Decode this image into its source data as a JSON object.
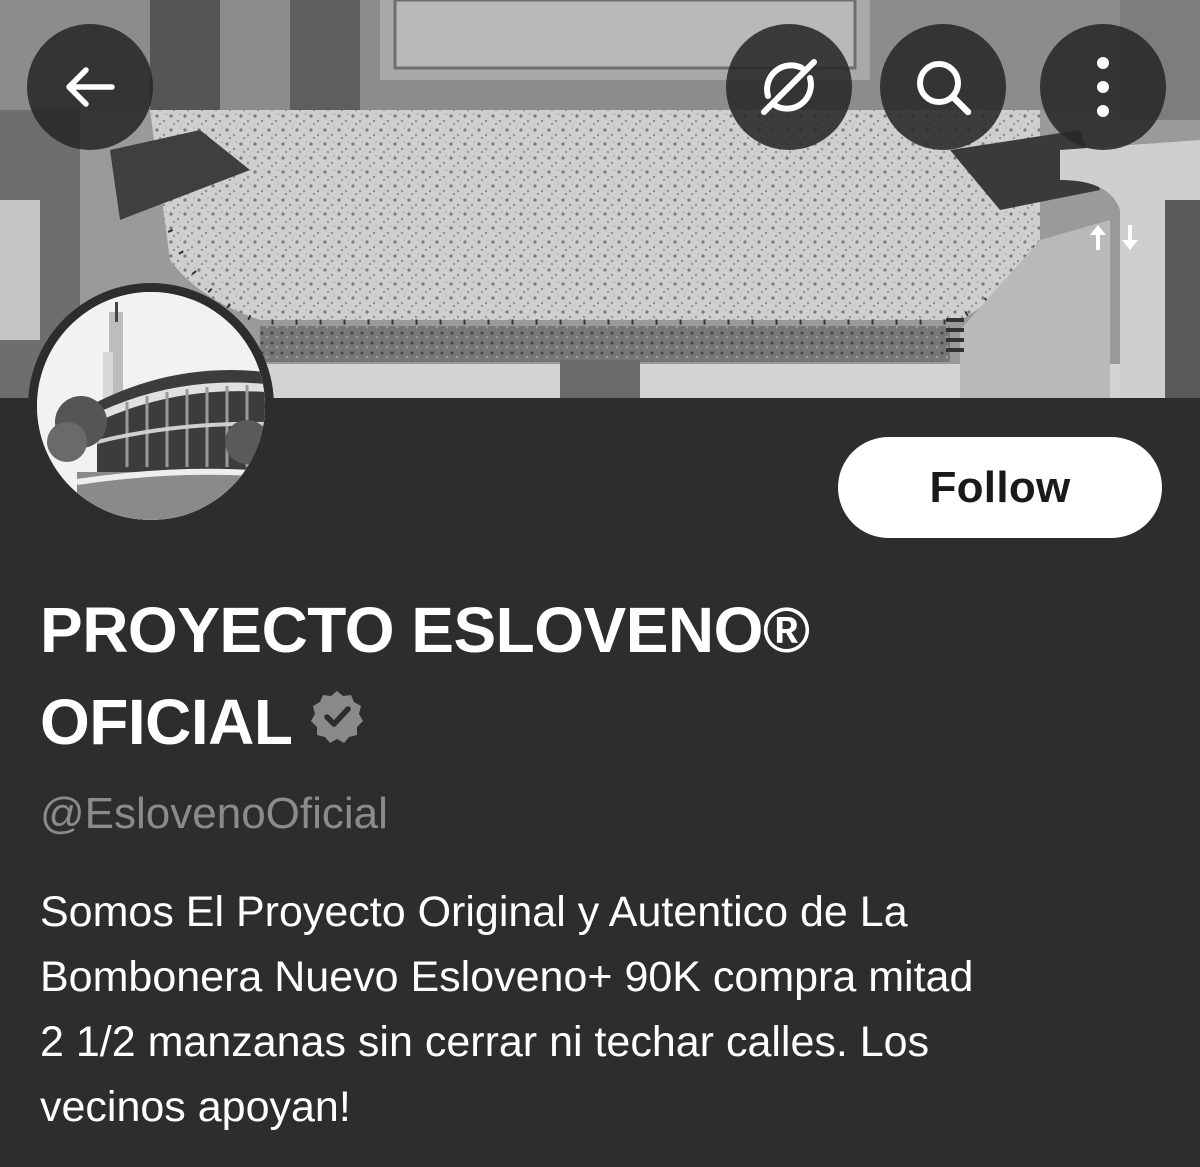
{
  "colors": {
    "background": "#2d2d2d",
    "text_primary": "#ffffff",
    "text_secondary": "#8b8b8b",
    "follow_bg": "#ffffff",
    "follow_text": "#1a1a1a",
    "badge": "#8a8a8a"
  },
  "header": {
    "back_icon": "arrow-left-icon",
    "grok_icon": "grok-icon",
    "search_icon": "search-icon",
    "more_icon": "more-vertical-icon"
  },
  "profile": {
    "name_line1": "PROYECTO ESLOVENO®",
    "name_line2": "OFICIAL",
    "verified_icon": "verified-badge-icon",
    "handle": "@EslovenoOficial",
    "follow_label": "Follow",
    "bio_lines": [
      "Somos El Proyecto Original y Autentico de La",
      "Bombonera Nuevo Esloveno+ 90K compra mitad",
      "2 1/2 manzanas sin cerrar ni techar calles. Los",
      "vecinos apoyan!"
    ]
  }
}
